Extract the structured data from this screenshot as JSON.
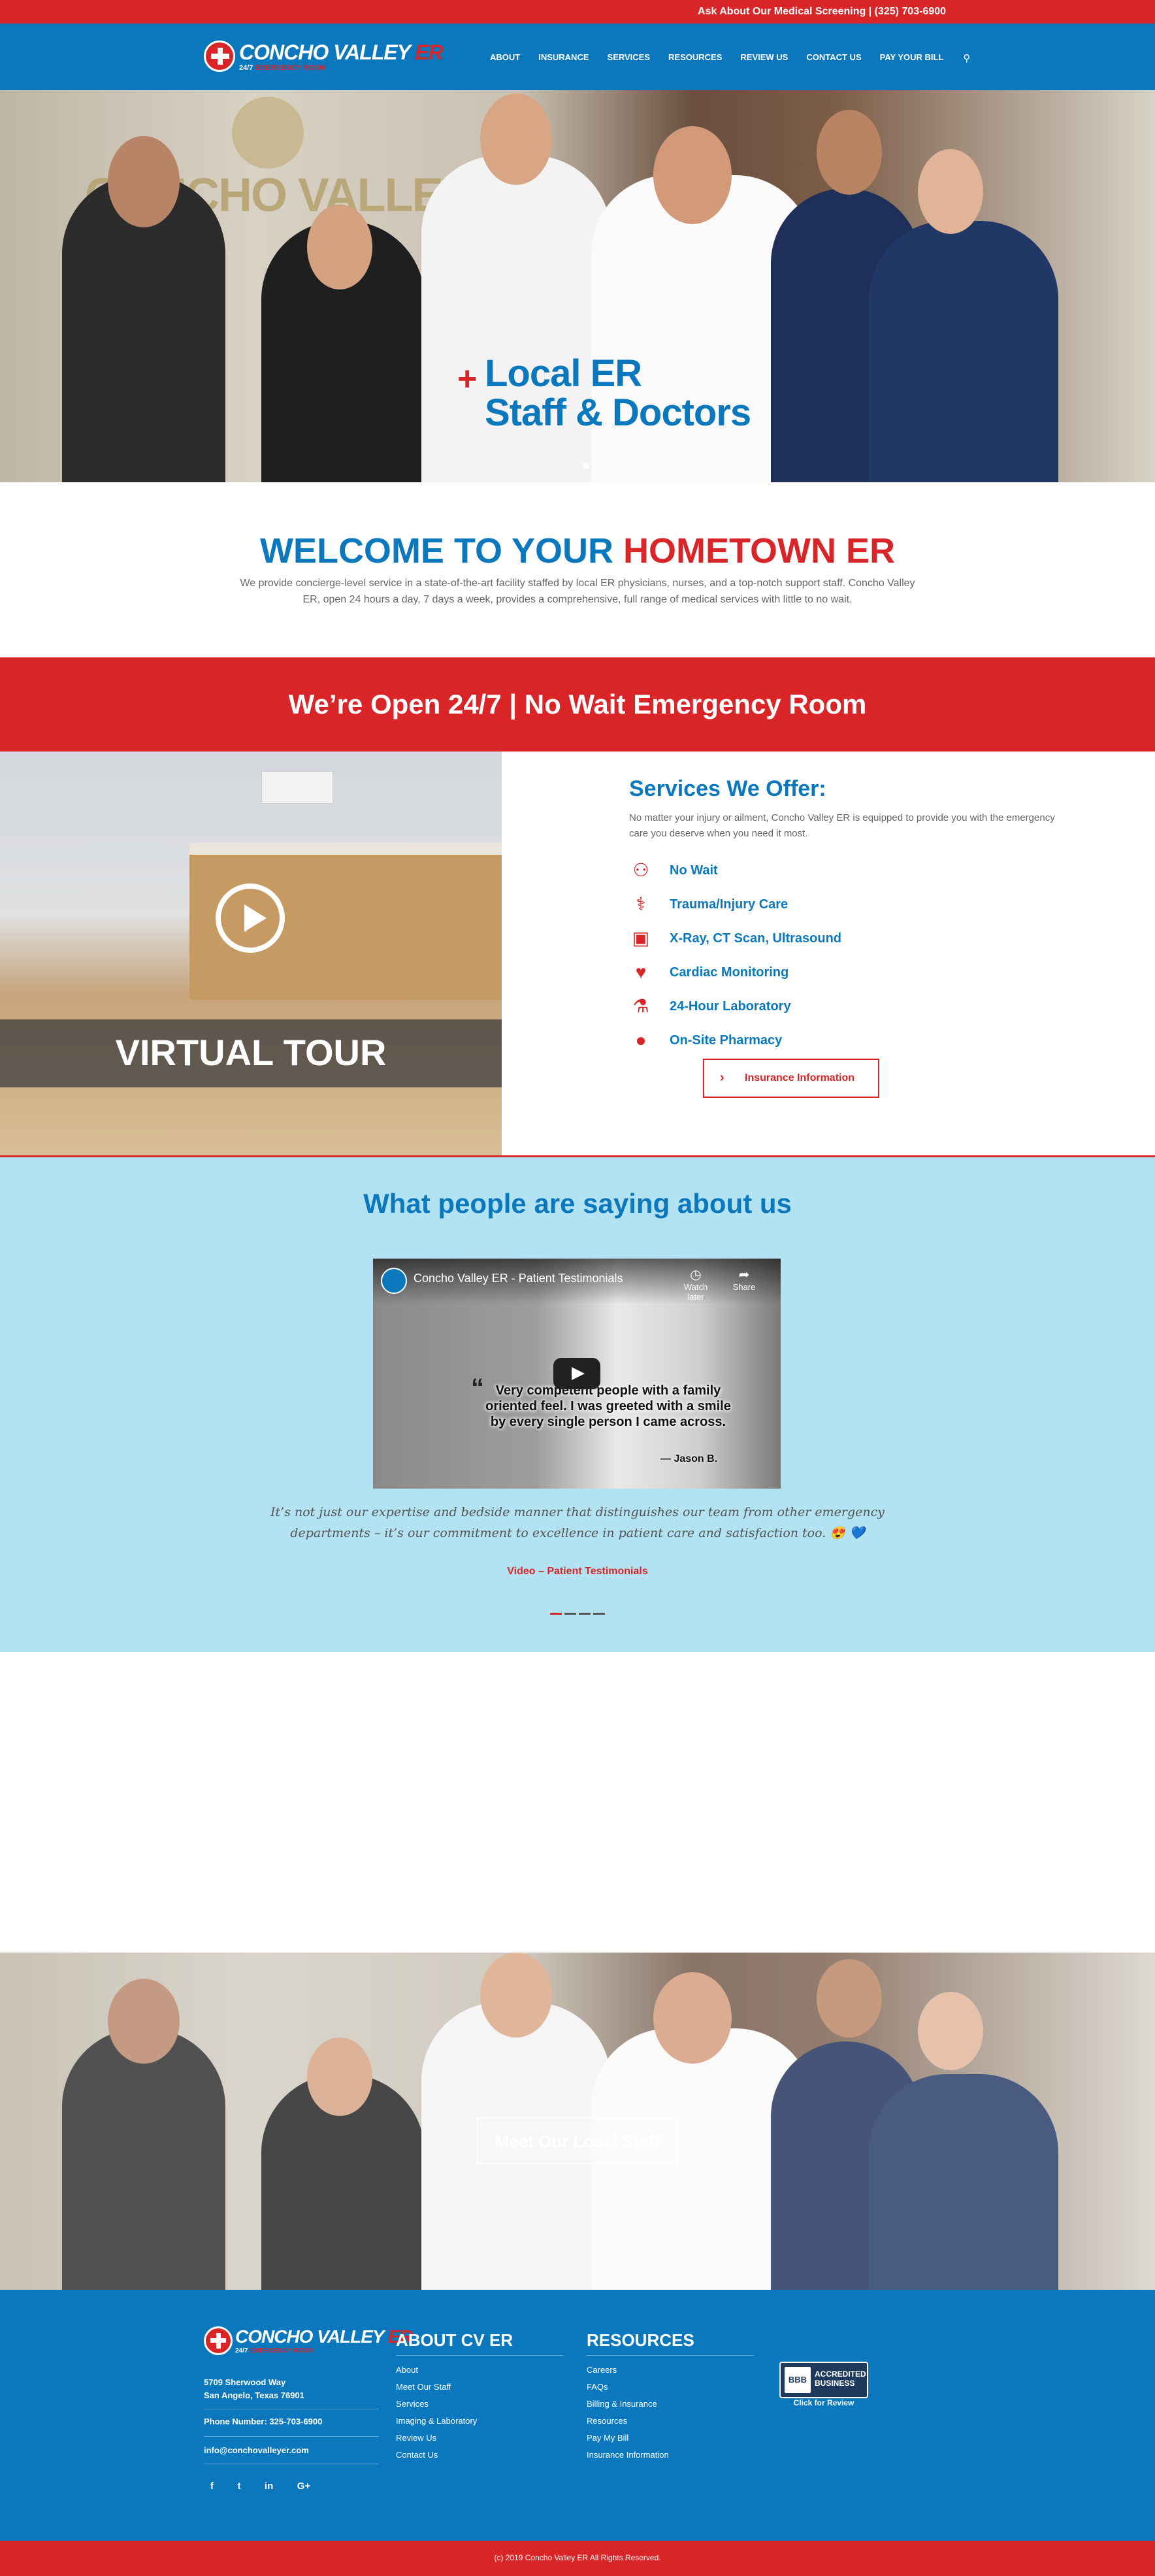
{
  "topbar": {
    "text": "Ask About Our Medical Screening | (325) 703-6900"
  },
  "header": {
    "logo_name": "CONCHO VALLEY",
    "logo_er": "ER",
    "logo_tag_a": "24/7",
    "logo_tag_b": "EMERGENCY ROOM",
    "nav": [
      "ABOUT",
      "INSURANCE",
      "SERVICES",
      "RESOURCES",
      "REVIEW US",
      "CONTACT US",
      "PAY YOUR BILL"
    ],
    "search_icon": "search-icon"
  },
  "hero": {
    "wall_sign": "CONCHO VALLEY ER",
    "title_line1": "Local ER",
    "title_line2": "Staff & Doctors",
    "plus": "+"
  },
  "welcome": {
    "title_blue": "WELCOME TO YOUR",
    "title_red": "HOMETOWN ER",
    "body": "We provide concierge-level service in a state-of-the-art facility staffed by local ER physicians, nurses, and a top-notch support staff. Concho Valley ER, open 24 hours a day, 7 days a week, provides a comprehensive, full range of medical services with little to no wait."
  },
  "banner": {
    "text": "We’re Open 24/7 | No Wait Emergency Room"
  },
  "tour": {
    "label": "VIRTUAL TOUR"
  },
  "services": {
    "title": "Services We Offer:",
    "intro": "No matter your injury or ailment, Concho Valley ER is equipped to provide you with the emergency care you deserve when you need it most.",
    "items": [
      {
        "label": "No Wait",
        "icon": "nurse-icon"
      },
      {
        "label": "Trauma/Injury Care",
        "icon": "injury-icon"
      },
      {
        "label": "X-Ray, CT Scan, Ultrasound",
        "icon": "xray-icon"
      },
      {
        "label": "Cardiac Monitoring",
        "icon": "heart-icon"
      },
      {
        "label": "24-Hour Laboratory",
        "icon": "lab-icon"
      },
      {
        "label": "On-Site Pharmacy",
        "icon": "pharmacy-icon"
      }
    ],
    "button": "Insurance Information"
  },
  "testimonials": {
    "title": "What people are saying about us",
    "video_title": "Concho Valley ER - Patient Testimonials",
    "watch_later": "Watch later",
    "share": "Share",
    "video_quote": "Very competent people with a family oriented feel. I was greeted with a smile by every single person I came across.",
    "video_author": "— Jason B.",
    "quote": "It’s not just our expertise and bedside manner that distinguishes our team from other emergency departments – it’s our commitment to excellence in patient care and satisfaction too. 😍 💙",
    "link": "Video – Patient Testimonials"
  },
  "staff": {
    "button": "Meet Our Local Staff"
  },
  "footer": {
    "address_line1": "5709 Sherwood Way",
    "address_line2": "San Angelo, Texas 76901",
    "phone": "Phone Number: 325-703-6900",
    "email": "info@conchovalleyer.com",
    "social": [
      "f",
      "t",
      "in",
      "G+"
    ],
    "about_title": "ABOUT CV ER",
    "about_links": [
      "About",
      "Meet Our Staff",
      "Services",
      "Imaging & Laboratory",
      "Review Us",
      "Contact Us"
    ],
    "resources_title": "RESOURCES",
    "resources_links": [
      "Careers",
      "FAQs",
      "Billing & Insurance",
      "Resources",
      "Pay My Bill",
      "Insurance Information"
    ],
    "bbb_line1": "ACCREDITED",
    "bbb_line2": "BUSINESS",
    "bbb_seal": "BBB",
    "bbb_cta": "Click for Review",
    "copyright": "(c) 2019 Concho Valley ER All Rights Reserved."
  },
  "colors": {
    "brand_blue": "#0b78bd",
    "brand_red": "#d92528",
    "testimonial_bg": "#b3e3f2"
  }
}
